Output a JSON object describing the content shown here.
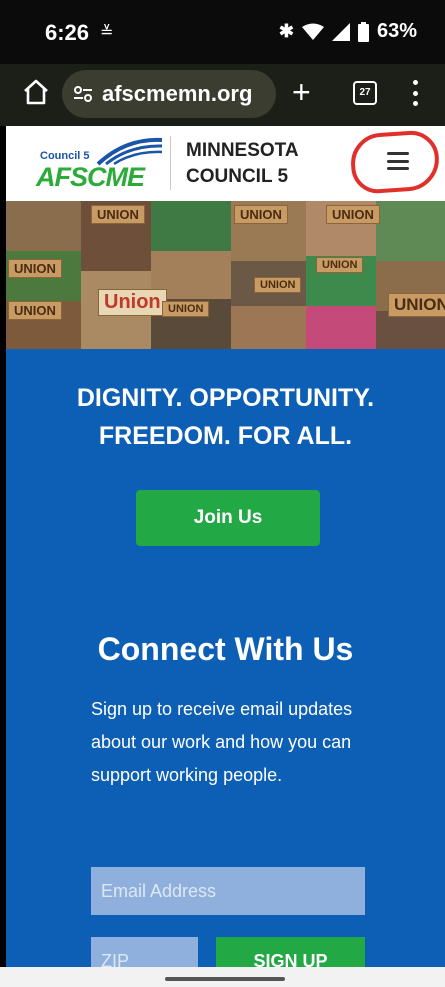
{
  "status_bar": {
    "time": "6:26",
    "battery": "63%"
  },
  "browser": {
    "url": "afscmemn.org",
    "tab_count": "27"
  },
  "header": {
    "logo_council": "Council 5",
    "logo_afscme": "AFSCME",
    "org_line1": "MINNESOTA",
    "org_line2": "COUNCIL 5"
  },
  "collage_signs": [
    "UNION",
    "UNION",
    "Union",
    "UNION",
    "UNION",
    "UNION",
    "UNION",
    "UNION",
    "UNION",
    "UNION"
  ],
  "hero": {
    "tagline_line1": "DIGNITY. OPPORTUNITY.",
    "tagline_line2": "FREEDOM. FOR ALL.",
    "join_label": "Join Us",
    "connect_title": "Connect With Us",
    "blurb": "Sign up to receive email updates about our work and how you can support working people.",
    "email_placeholder": "Email Address",
    "zip_placeholder": "ZIP",
    "signup_label": "SIGN UP"
  },
  "colors": {
    "hero_blue": "#0c5fb4",
    "button_green": "#22a845",
    "annotation_red": "#e0302a"
  }
}
